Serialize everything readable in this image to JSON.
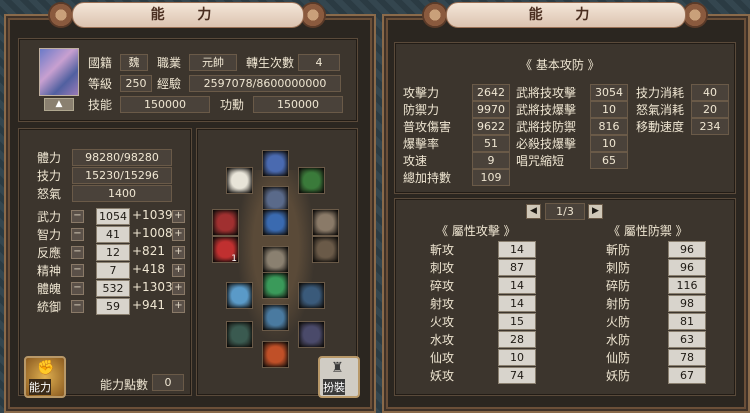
{
  "left_title": "能 力",
  "right_title": "能 力",
  "profile": {
    "nationality_label": "國籍",
    "nationality": "魏",
    "job_label": "職業",
    "job": "元帥",
    "rebirth_label": "轉生次數",
    "rebirth": "4",
    "level_label": "等級",
    "level": "250",
    "exp_label": "經驗",
    "exp": "2597078/8600000000",
    "skill_label": "技能",
    "skill": "150000",
    "merit_label": "功勳",
    "merit": "150000",
    "arrow_icon": "up-arrow-icon"
  },
  "vitals": [
    {
      "label": "體力",
      "value": "98280/98280"
    },
    {
      "label": "技力",
      "value": "15230/15296"
    },
    {
      "label": "怒氣",
      "value": "1400"
    }
  ],
  "attributes": [
    {
      "label": "武力",
      "value": "1054",
      "bonus": "+1039"
    },
    {
      "label": "智力",
      "value": "41",
      "bonus": "+1008"
    },
    {
      "label": "反應",
      "value": "12",
      "bonus": "+821"
    },
    {
      "label": "精神",
      "value": "7",
      "bonus": "+418"
    },
    {
      "label": "體魄",
      "value": "532",
      "bonus": "+1303"
    },
    {
      "label": "統御",
      "value": "59",
      "bonus": "+941"
    }
  ],
  "minus": "−",
  "plus": "+",
  "points_label": "能力點數",
  "points_value": "0",
  "ability_button": "能力",
  "dress_button": "扮裝",
  "equip_slot_count_badge": "1",
  "basic_header": "《 基本攻防 》",
  "basic_left": [
    {
      "label": "攻擊力",
      "value": "2642"
    },
    {
      "label": "防禦力",
      "value": "9970"
    },
    {
      "label": "普攻傷害",
      "value": "9622"
    },
    {
      "label": "爆擊率",
      "value": "51"
    },
    {
      "label": "攻速",
      "value": "9"
    },
    {
      "label": "總加持數",
      "value": "109"
    }
  ],
  "basic_mid": [
    {
      "label": "武將技攻擊",
      "value": "3054"
    },
    {
      "label": "武將技爆擊",
      "value": "10"
    },
    {
      "label": "武將技防禦",
      "value": "816"
    },
    {
      "label": "必殺技爆擊",
      "value": "10"
    },
    {
      "label": "唱咒縮短",
      "value": "65"
    }
  ],
  "basic_right": [
    {
      "label": "技力消耗",
      "value": "40"
    },
    {
      "label": "怒氣消耗",
      "value": "20"
    },
    {
      "label": "移動速度",
      "value": "234"
    }
  ],
  "page": {
    "prev": "◀",
    "text": "1/3",
    "next": "▶"
  },
  "attack_header": "《 屬性攻擊 》",
  "defense_header": "《 屬性防禦 》",
  "attack_attrs": [
    {
      "label": "斬攻",
      "value": "14"
    },
    {
      "label": "刺攻",
      "value": "87"
    },
    {
      "label": "碎攻",
      "value": "14"
    },
    {
      "label": "射攻",
      "value": "14"
    },
    {
      "label": "火攻",
      "value": "15"
    },
    {
      "label": "水攻",
      "value": "28"
    },
    {
      "label": "仙攻",
      "value": "10"
    },
    {
      "label": "妖攻",
      "value": "74"
    }
  ],
  "defense_attrs": [
    {
      "label": "斬防",
      "value": "96"
    },
    {
      "label": "刺防",
      "value": "96"
    },
    {
      "label": "碎防",
      "value": "116"
    },
    {
      "label": "射防",
      "value": "98"
    },
    {
      "label": "火防",
      "value": "81"
    },
    {
      "label": "水防",
      "value": "63"
    },
    {
      "label": "仙防",
      "value": "78"
    },
    {
      "label": "妖防",
      "value": "67"
    }
  ]
}
